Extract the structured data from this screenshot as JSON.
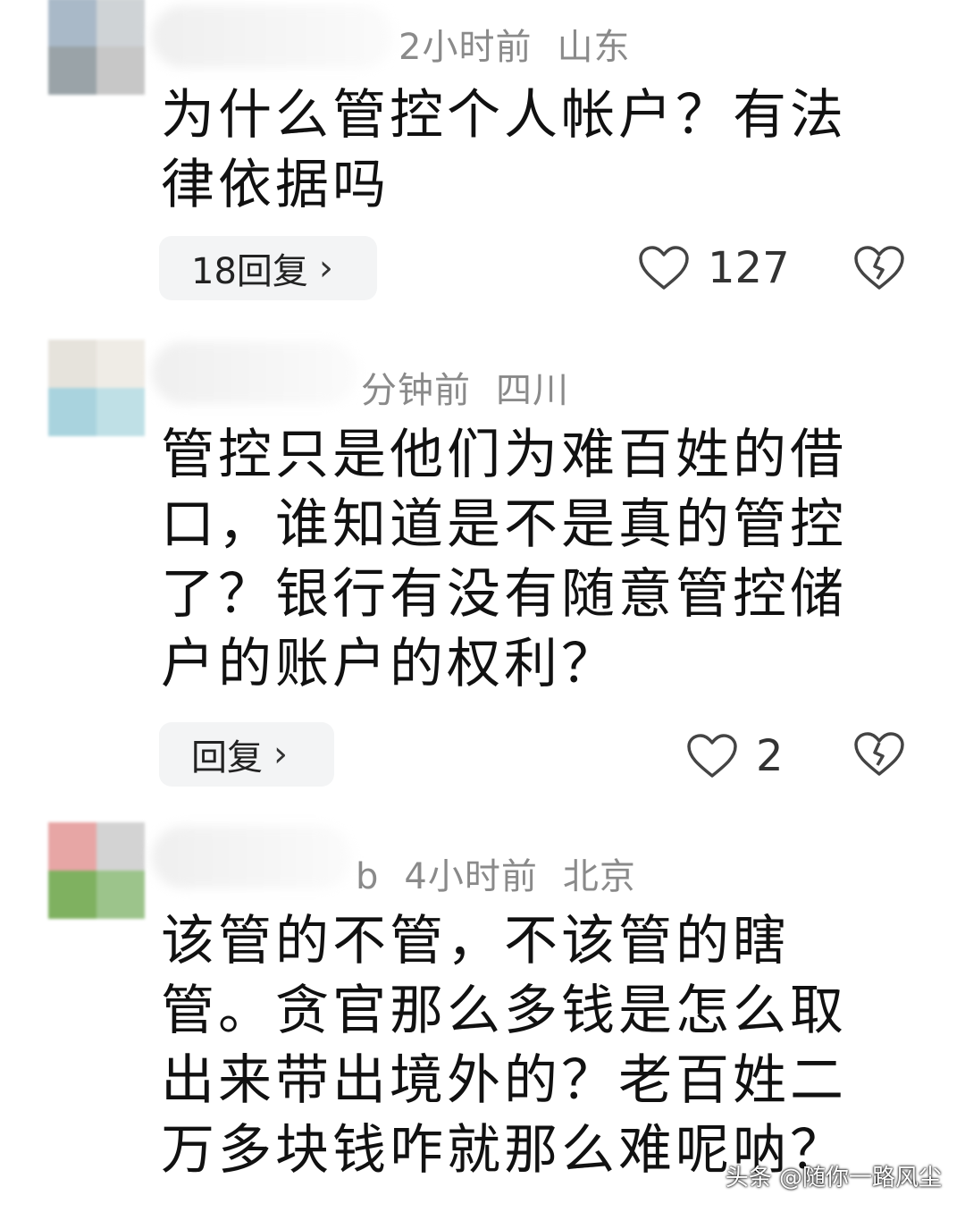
{
  "comments": [
    {
      "meta_time": "2小时前",
      "meta_location": "山东",
      "text": "为什么管控个人帐户？有法律依据吗",
      "reply_label": "18回复",
      "like_count": "127",
      "avatar_colors": [
        "#a9b9c8",
        "#cfd3d6",
        "#9aa3a8",
        "#c7c7c7"
      ]
    },
    {
      "meta_time": "分钟前",
      "meta_location": "四川",
      "text": "管控只是他们为难百姓的借口，谁知道是不是真的管控了？银行有没有随意管控储户的账户的权利？",
      "reply_label": "回复",
      "like_count": "2",
      "avatar_colors": [
        "#e6e3dc",
        "#efece6",
        "#a9d3de",
        "#bfe0e6"
      ]
    },
    {
      "meta_prefix": "b",
      "meta_time": "4小时前",
      "meta_location": "北京",
      "text": "该管的不管，不该管的瞎管。贪官那么多钱是怎么取出来带出境外的？老百姓二万多块钱咋就那么难呢呐？",
      "avatar_colors": [
        "#e7a6a5",
        "#d3d3d3",
        "#7fb160",
        "#9cc48b"
      ]
    }
  ],
  "watermark": "头条 @随你一路风尘",
  "icons": {
    "chevron": "›"
  }
}
